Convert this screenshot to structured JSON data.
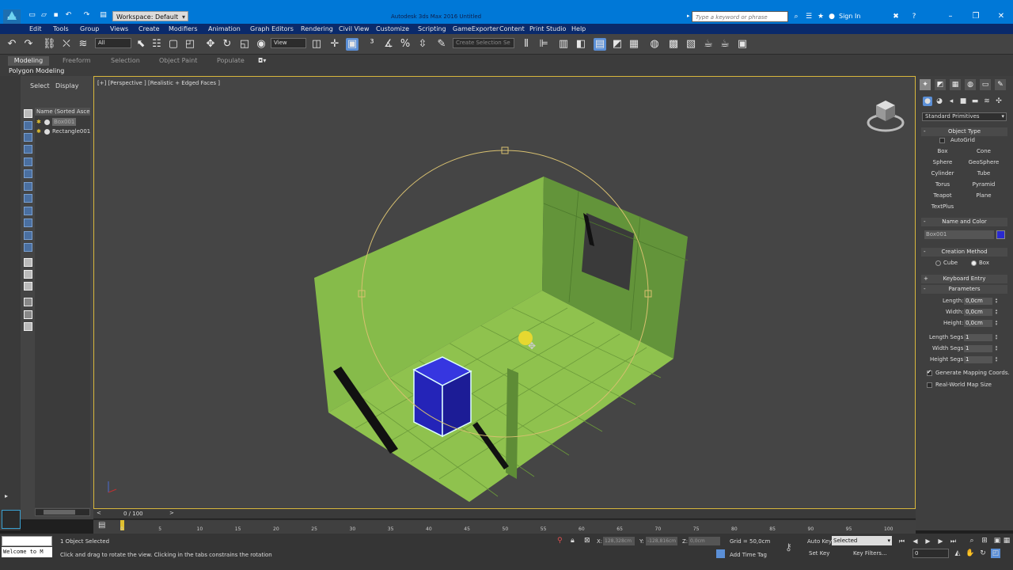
{
  "titlebar": {
    "app_logo": "MAX",
    "workspace": "Workspace: Default",
    "title": "Autodesk 3ds Max 2016     Untitled",
    "search_placeholder": "Type a keyword or phrase",
    "sign_in": "Sign In"
  },
  "menu": [
    "Edit",
    "Tools",
    "Group",
    "Views",
    "Create",
    "Modifiers",
    "Animation",
    "Graph Editors",
    "Rendering",
    "Civil View",
    "Customize",
    "Scripting",
    "GameExporter",
    "Content",
    "Print Studio",
    "Help"
  ],
  "toolbar": {
    "filter_value": "All",
    "ref_coord_value": "View",
    "selection_set_placeholder": "Create Selection Se"
  },
  "ribbon": {
    "tabs": [
      "Modeling",
      "Freeform",
      "Selection",
      "Object Paint",
      "Populate"
    ],
    "active_panel": "Polygon Modeling"
  },
  "scene_explorer": {
    "tabs": [
      "Select",
      "Display"
    ],
    "header": "Name (Sorted Ascending)",
    "rows": [
      "Box001",
      "Rectangle001"
    ]
  },
  "viewport": {
    "label": "[+] [Perspective ] [Realistic + Edged Faces ]",
    "colors": {
      "box": "#2a2ac8",
      "room": "#8fc24e",
      "border": "#d8b73c"
    }
  },
  "command_panel": {
    "category": "Standard Primitives",
    "object_type": {
      "title": "Object Type",
      "autogrid": "AutoGrid",
      "buttons": [
        "Box",
        "Cone",
        "Sphere",
        "GeoSphere",
        "Cylinder",
        "Tube",
        "Torus",
        "Pyramid",
        "Teapot",
        "Plane",
        "TextPlus"
      ]
    },
    "name_color": {
      "title": "Name and Color",
      "name": "Box001"
    },
    "creation_method": {
      "title": "Creation Method",
      "options": [
        "Cube",
        "Box"
      ],
      "selected": "Box"
    },
    "keyboard_entry": "Keyboard Entry",
    "parameters": {
      "title": "Parameters",
      "fields": [
        {
          "label": "Length:",
          "value": "0,0cm"
        },
        {
          "label": "Width:",
          "value": "0,0cm"
        },
        {
          "label": "Height:",
          "value": "0,0cm"
        },
        {
          "label": "Length Segs:",
          "value": "1"
        },
        {
          "label": "Width Segs:",
          "value": "1"
        },
        {
          "label": "Height Segs:",
          "value": "1"
        }
      ],
      "generate_mapping": "Generate Mapping Coords.",
      "real_world": "Real-World Map Size"
    }
  },
  "timeline": {
    "frame": "0 / 100",
    "ticks": [
      "0",
      "5",
      "10",
      "15",
      "20",
      "25",
      "30",
      "35",
      "40",
      "45",
      "50",
      "55",
      "60",
      "65",
      "70",
      "75",
      "80",
      "85",
      "90",
      "95",
      "100"
    ]
  },
  "status": {
    "maxscript": "Welcome to M",
    "selection": "1 Object Selected",
    "prompt": "Click and drag to rotate the view.  Clicking in the tabs constrains the rotation",
    "x_label": "X:",
    "x_value": "128,328cm",
    "y_label": "Y:",
    "y_value": "-128,816cm",
    "z_label": "Z:",
    "z_value": "0,0cm",
    "grid": "Grid = 50,0cm",
    "add_time_tag": "Add Time Tag",
    "auto_key": "Auto Key",
    "set_key": "Set Key",
    "selected_dd": "Selected",
    "key_filters": "Key Filters...",
    "frame_field": "0"
  }
}
